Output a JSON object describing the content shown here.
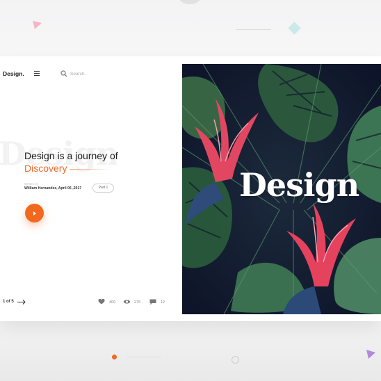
{
  "app": {
    "brand": "Design."
  },
  "search": {
    "placeholder": "Search"
  },
  "hero": {
    "ghost_text": "Design",
    "headline_line1": "Design is a journey of",
    "headline_accent": "Discovery",
    "written_label": "Written by",
    "author_date": "William Hernandez, April 06 ,2017",
    "part_label": "Part 1"
  },
  "footer": {
    "pager": "1 of 5",
    "likes": "400",
    "views": "275",
    "comments": "12"
  },
  "image": {
    "title": "Design"
  },
  "colors": {
    "accent": "#f2681e",
    "panel_bg": "#111733",
    "leaf": "#2f6d45",
    "flower": "#e84a6a"
  },
  "icons": [
    "menu-icon",
    "search-icon",
    "play-icon",
    "arrow-right-icon",
    "heart-icon",
    "eye-icon",
    "comment-icon"
  ]
}
